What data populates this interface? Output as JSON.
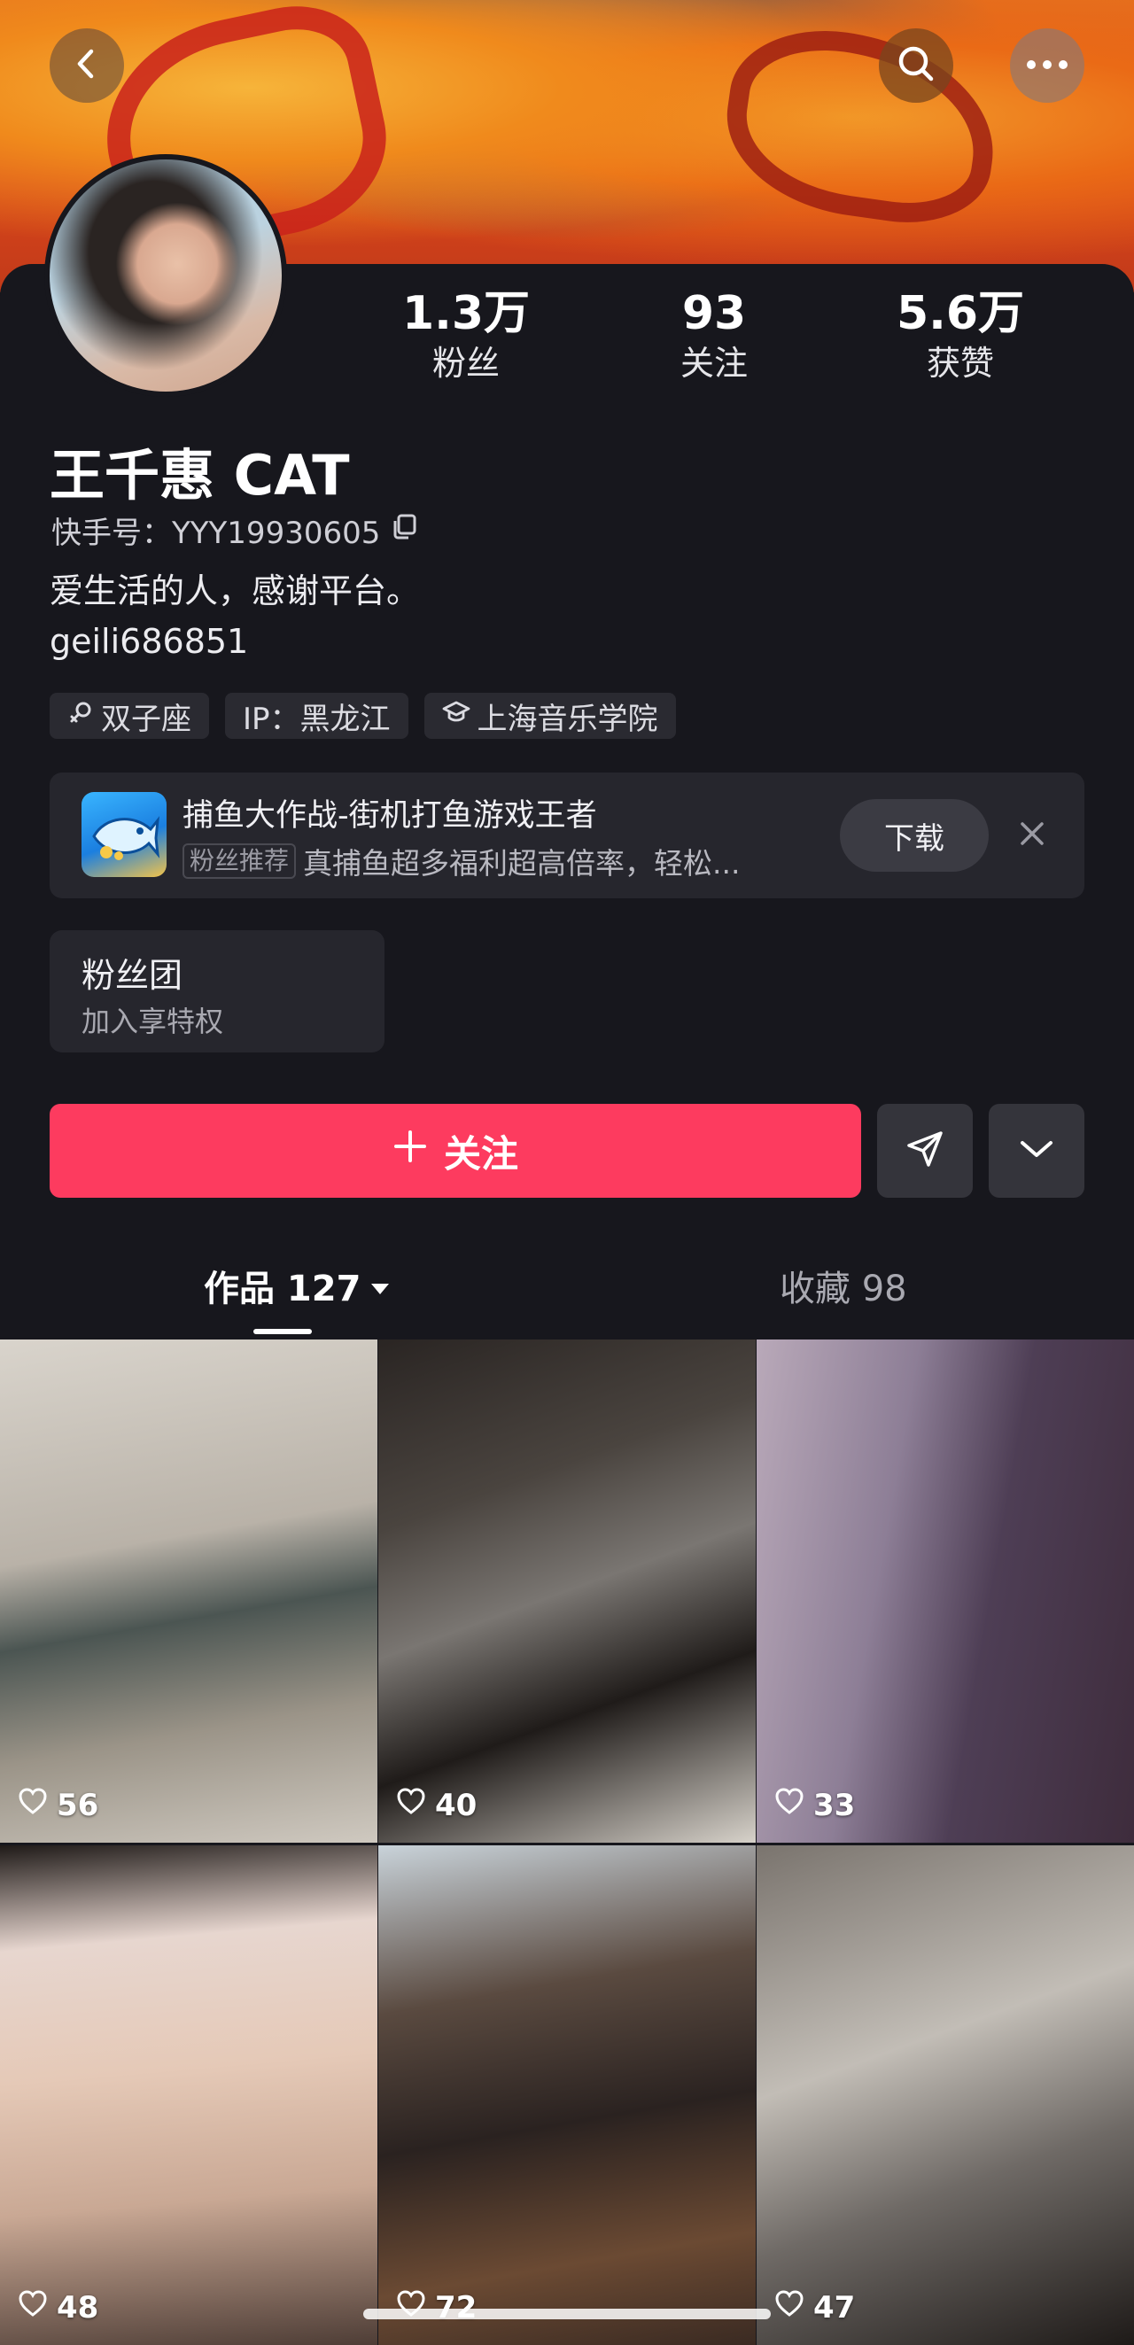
{
  "header": {
    "back_icon": "chevron-left-icon",
    "search_icon": "search-icon",
    "more_icon": "more-horizontal-icon"
  },
  "profile": {
    "name": "王千惠 CAT",
    "kuaishou_id": "快手号：YYY19930605",
    "bio": "爱生活的人，感谢平台。",
    "extra_line": "geili686851",
    "stats": [
      {
        "value": "1.3万",
        "label": "粉丝"
      },
      {
        "value": "93",
        "label": "关注"
      },
      {
        "value": "5.6万",
        "label": "获赞"
      }
    ],
    "tags": [
      {
        "icon": "zodiac-icon",
        "label": "双子座"
      },
      {
        "icon": "",
        "label": "IP：黑龙江"
      },
      {
        "icon": "graduation-cap-icon",
        "label": "上海音乐学院"
      }
    ]
  },
  "ad": {
    "title": "捕鱼大作战-街机打鱼游戏王者",
    "badge": "粉丝推荐",
    "subtitle": "真捕鱼超多福利超高倍率，轻松...",
    "download_label": "下载"
  },
  "fan_group": {
    "title": "粉丝团",
    "subtitle": "加入享特权"
  },
  "actions": {
    "follow_label": "关注",
    "colors": {
      "follow": "#fd3b5f"
    }
  },
  "tabs": {
    "works_label": "作品 127",
    "favorites_label": "收藏 98"
  },
  "grid": [
    {
      "likes": "56"
    },
    {
      "likes": "40"
    },
    {
      "likes": "33"
    },
    {
      "likes": "48"
    },
    {
      "likes": "72"
    },
    {
      "likes": "47"
    }
  ]
}
